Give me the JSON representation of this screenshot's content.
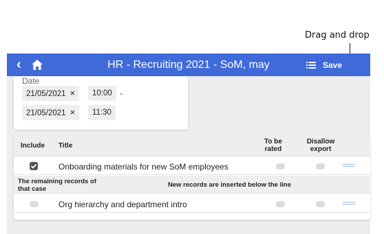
{
  "annotation": {
    "label": "Drag and drop"
  },
  "appbar": {
    "back_icon": "chevron-left-icon",
    "home_icon": "home-icon",
    "title": "HR - Recruiting 2021 - SoM, may",
    "list_icon": "list-icon",
    "save_label": "Save",
    "color": "#3f6ad8"
  },
  "date_card": {
    "label": "Date",
    "ranges": [
      {
        "date": "21/05/2021",
        "time": "10:00",
        "separator": "-"
      },
      {
        "date": "21/05/2021",
        "time": "11:30"
      }
    ],
    "clear_symbol": "×"
  },
  "table": {
    "headers": {
      "include": "Include",
      "title": "Title",
      "to_be_rated": [
        "To be",
        "rated"
      ],
      "disallow_export": [
        "Disallow",
        "export"
      ]
    },
    "rows_above": [
      {
        "include": true,
        "title": "Onboarding materials for new SoM employees",
        "to_be_rated": false,
        "disallow_export": false
      }
    ],
    "divider": {
      "left": [
        "The remaining records of",
        "that case"
      ],
      "center": "New records are inserted below the line"
    },
    "rows_below": [
      {
        "include": false,
        "title": "Org hierarchy and department intro",
        "to_be_rated": false,
        "disallow_export": false
      }
    ]
  }
}
